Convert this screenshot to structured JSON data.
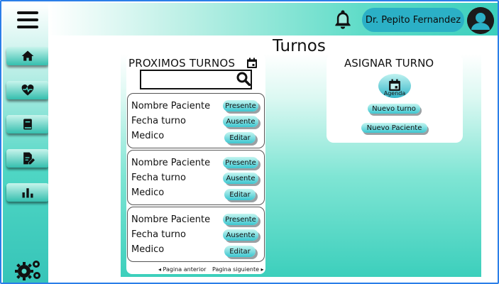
{
  "header": {
    "user_name": "Dr. Pepito Fernandez",
    "icons": [
      "menu-icon",
      "bell-icon",
      "user-avatar-icon"
    ]
  },
  "sidebar": {
    "items": [
      {
        "name": "home",
        "icon": "home-icon"
      },
      {
        "name": "health",
        "icon": "heart-pulse-icon"
      },
      {
        "name": "records",
        "icon": "book-icon"
      },
      {
        "name": "edit-document",
        "icon": "document-edit-icon"
      },
      {
        "name": "stats",
        "icon": "bar-chart-icon"
      }
    ],
    "settings_icon": "gears-icon"
  },
  "page": {
    "title": "Turnos"
  },
  "upcoming": {
    "title": "PROXIMOS TURNOS",
    "search_placeholder": "",
    "cards": [
      {
        "patient": "Nombre Paciente",
        "date": "Fecha turno",
        "doctor": "Medico",
        "present": "Presente",
        "absent": "Ausente",
        "edit": "Editar"
      },
      {
        "patient": "Nombre Paciente",
        "date": "Fecha turno",
        "doctor": "Medico",
        "present": "Presente",
        "absent": "Ausente",
        "edit": "Editar"
      },
      {
        "patient": "Nombre Paciente",
        "date": "Fecha turno",
        "doctor": "Medico",
        "present": "Presente",
        "absent": "Ausente",
        "edit": "Editar"
      }
    ],
    "prev_page": "◂ Pagina anterior",
    "next_page": "Pagina siguiente ▸"
  },
  "assign": {
    "title": "ASIGNAR TURNO",
    "agenda_label": "Agenda",
    "new_appointment": "Nuevo turno",
    "new_patient": "Nuevo Paciente"
  },
  "colors": {
    "accent": "#2bb0c6",
    "gradient_teal": "#3ccfbd",
    "frame_border": "#2a7ee8"
  }
}
